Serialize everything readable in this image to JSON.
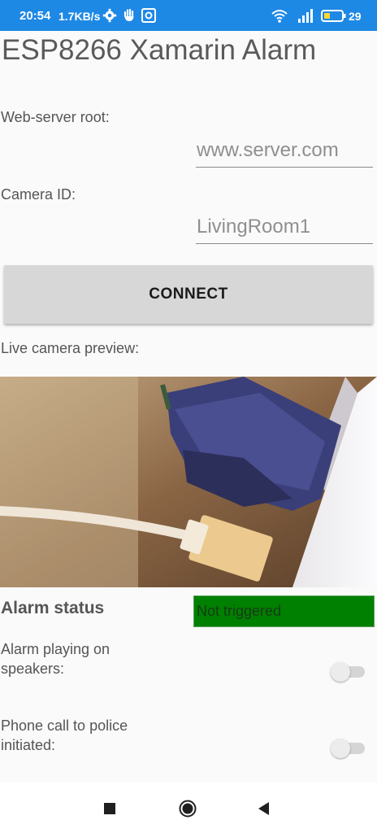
{
  "status_bar": {
    "time": "20:54",
    "speed": "1.7KB/s",
    "battery": "29"
  },
  "app": {
    "title": "ESP8266 Xamarin Alarm"
  },
  "form": {
    "server_label": "Web-server root:",
    "server_value": "www.server.com",
    "camera_label": "Camera ID:",
    "camera_value": "LivingRoom1",
    "connect_label": "CONNECT",
    "preview_label": "Live camera preview:"
  },
  "alarm": {
    "status_label": "Alarm status",
    "status_value": "Not triggered",
    "status_color": "#008000",
    "speakers_label": "Alarm playing on speakers:",
    "speakers_on": false,
    "police_label": "Phone call to police initiated:",
    "police_on": false
  },
  "colors": {
    "status_bar": "#1e88e5",
    "background": "#fafafa"
  }
}
